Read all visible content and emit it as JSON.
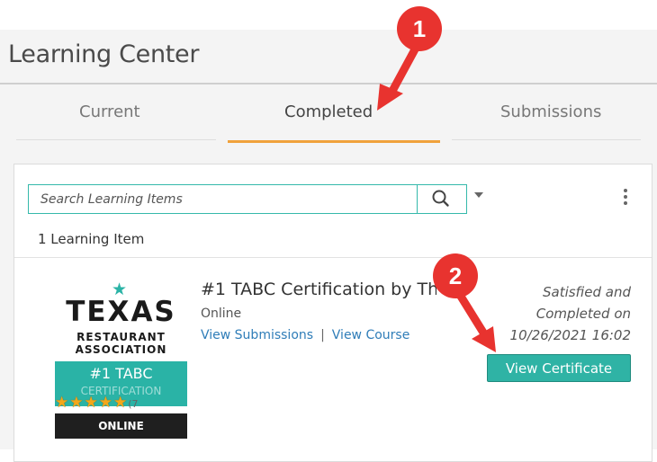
{
  "header": {
    "title": "Learning Center"
  },
  "tabs": [
    {
      "label": "Current"
    },
    {
      "label": "Completed",
      "active": true
    },
    {
      "label": "Submissions"
    }
  ],
  "search": {
    "placeholder": "Search Learning Items",
    "value": ""
  },
  "results": {
    "count_label": "1 Learning Item"
  },
  "item": {
    "thumbnail": {
      "line1": "TEXAS",
      "line2": "RESTAURANT",
      "line3": "ASSOCIATION",
      "line4": "#1 TABC",
      "line5": "CERTIFICATION",
      "stars": "★★★★★",
      "rating_text": "(7",
      "format_badge": "ONLINE"
    },
    "title": "#1 TABC Certification by Th",
    "type": "Online",
    "link_submissions": "View Submissions",
    "link_separator": "|",
    "link_course": "View Course",
    "status_line1": "Satisfied and",
    "status_line2": "Completed on",
    "status_line3": "10/26/2021 16:02",
    "action_label": "View Certificate"
  },
  "annotations": [
    {
      "number": "1"
    },
    {
      "number": "2"
    }
  ],
  "colors": {
    "accent_teal": "#2fb3a5",
    "tab_underline": "#f0a23c",
    "link": "#2f7db8",
    "annotation_red": "#e8332f"
  }
}
